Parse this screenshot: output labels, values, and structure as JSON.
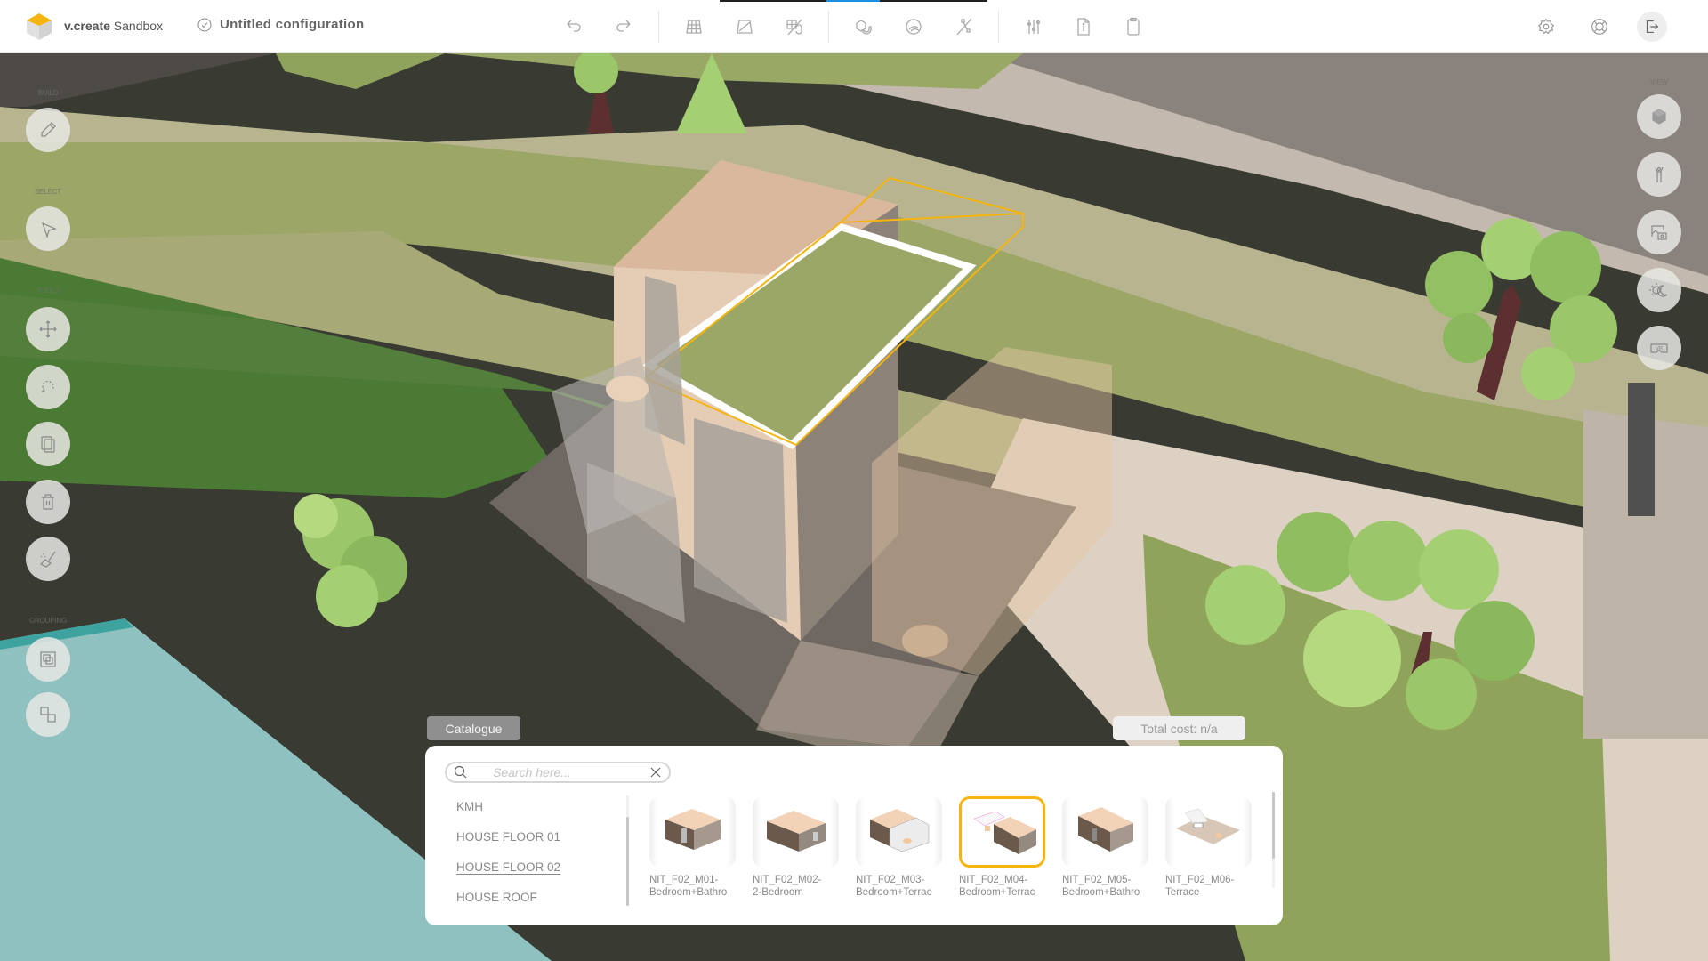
{
  "header": {
    "brand_bold": "v.create",
    "brand_rest": " Sandbox",
    "config_title": "Untitled configuration",
    "accent_color": "#f5b50e",
    "tab_indicator_color": "#1a8fe3",
    "toolbar": [
      {
        "name": "undo-icon",
        "label": "Undo"
      },
      {
        "name": "redo-icon",
        "label": "Redo"
      },
      {
        "name": "grid-icon",
        "label": "Grid"
      },
      {
        "name": "perspective-icon",
        "label": "Perspective"
      },
      {
        "name": "grid-snap-icon",
        "label": "Grid snap"
      },
      {
        "name": "object-snap-icon",
        "label": "Object snap"
      },
      {
        "name": "globe-icon",
        "label": "Globe"
      },
      {
        "name": "measure-icon",
        "label": "Measure"
      },
      {
        "name": "sliders-icon",
        "label": "Settings sliders"
      },
      {
        "name": "info-document-icon",
        "label": "Info"
      },
      {
        "name": "clipboard-icon",
        "label": "Clipboard"
      }
    ],
    "right": [
      {
        "name": "settings-icon"
      },
      {
        "name": "help-lifebuoy-icon"
      },
      {
        "name": "logout-icon"
      }
    ]
  },
  "left_toolbar": {
    "build_label": "BUILD",
    "select_label": "SELECT",
    "tools_label": "TOOLS",
    "grouping_label": "GROUPING"
  },
  "right_toolbar": {
    "view_label": "VIEW",
    "vr_label": "VR"
  },
  "catalogue": {
    "tab_label": "Catalogue",
    "total_cost": "Total cost: n/a",
    "search_placeholder": "Search here...",
    "search_value": "",
    "categories": [
      {
        "label": "KMH",
        "active": false
      },
      {
        "label": "HOUSE FLOOR 01",
        "active": false
      },
      {
        "label": "HOUSE FLOOR 02",
        "active": true
      },
      {
        "label": "HOUSE ROOF",
        "active": false
      }
    ],
    "items": [
      {
        "line1": "NIT_F02_M01-",
        "line2": "Bedroom+Bathro",
        "selected": false
      },
      {
        "line1": "NIT_F02_M02-",
        "line2": "2-Bedroom",
        "selected": false
      },
      {
        "line1": "NIT_F02_M03-",
        "line2": "Bedroom+Terrac",
        "selected": false
      },
      {
        "line1": "NIT_F02_M04-",
        "line2": "Bedroom+Terrac",
        "selected": true
      },
      {
        "line1": "NIT_F02_M05-",
        "line2": "Bedroom+Bathro",
        "selected": false
      },
      {
        "line1": "NIT_F02_M06-",
        "line2": "Terrace",
        "selected": false
      }
    ]
  }
}
